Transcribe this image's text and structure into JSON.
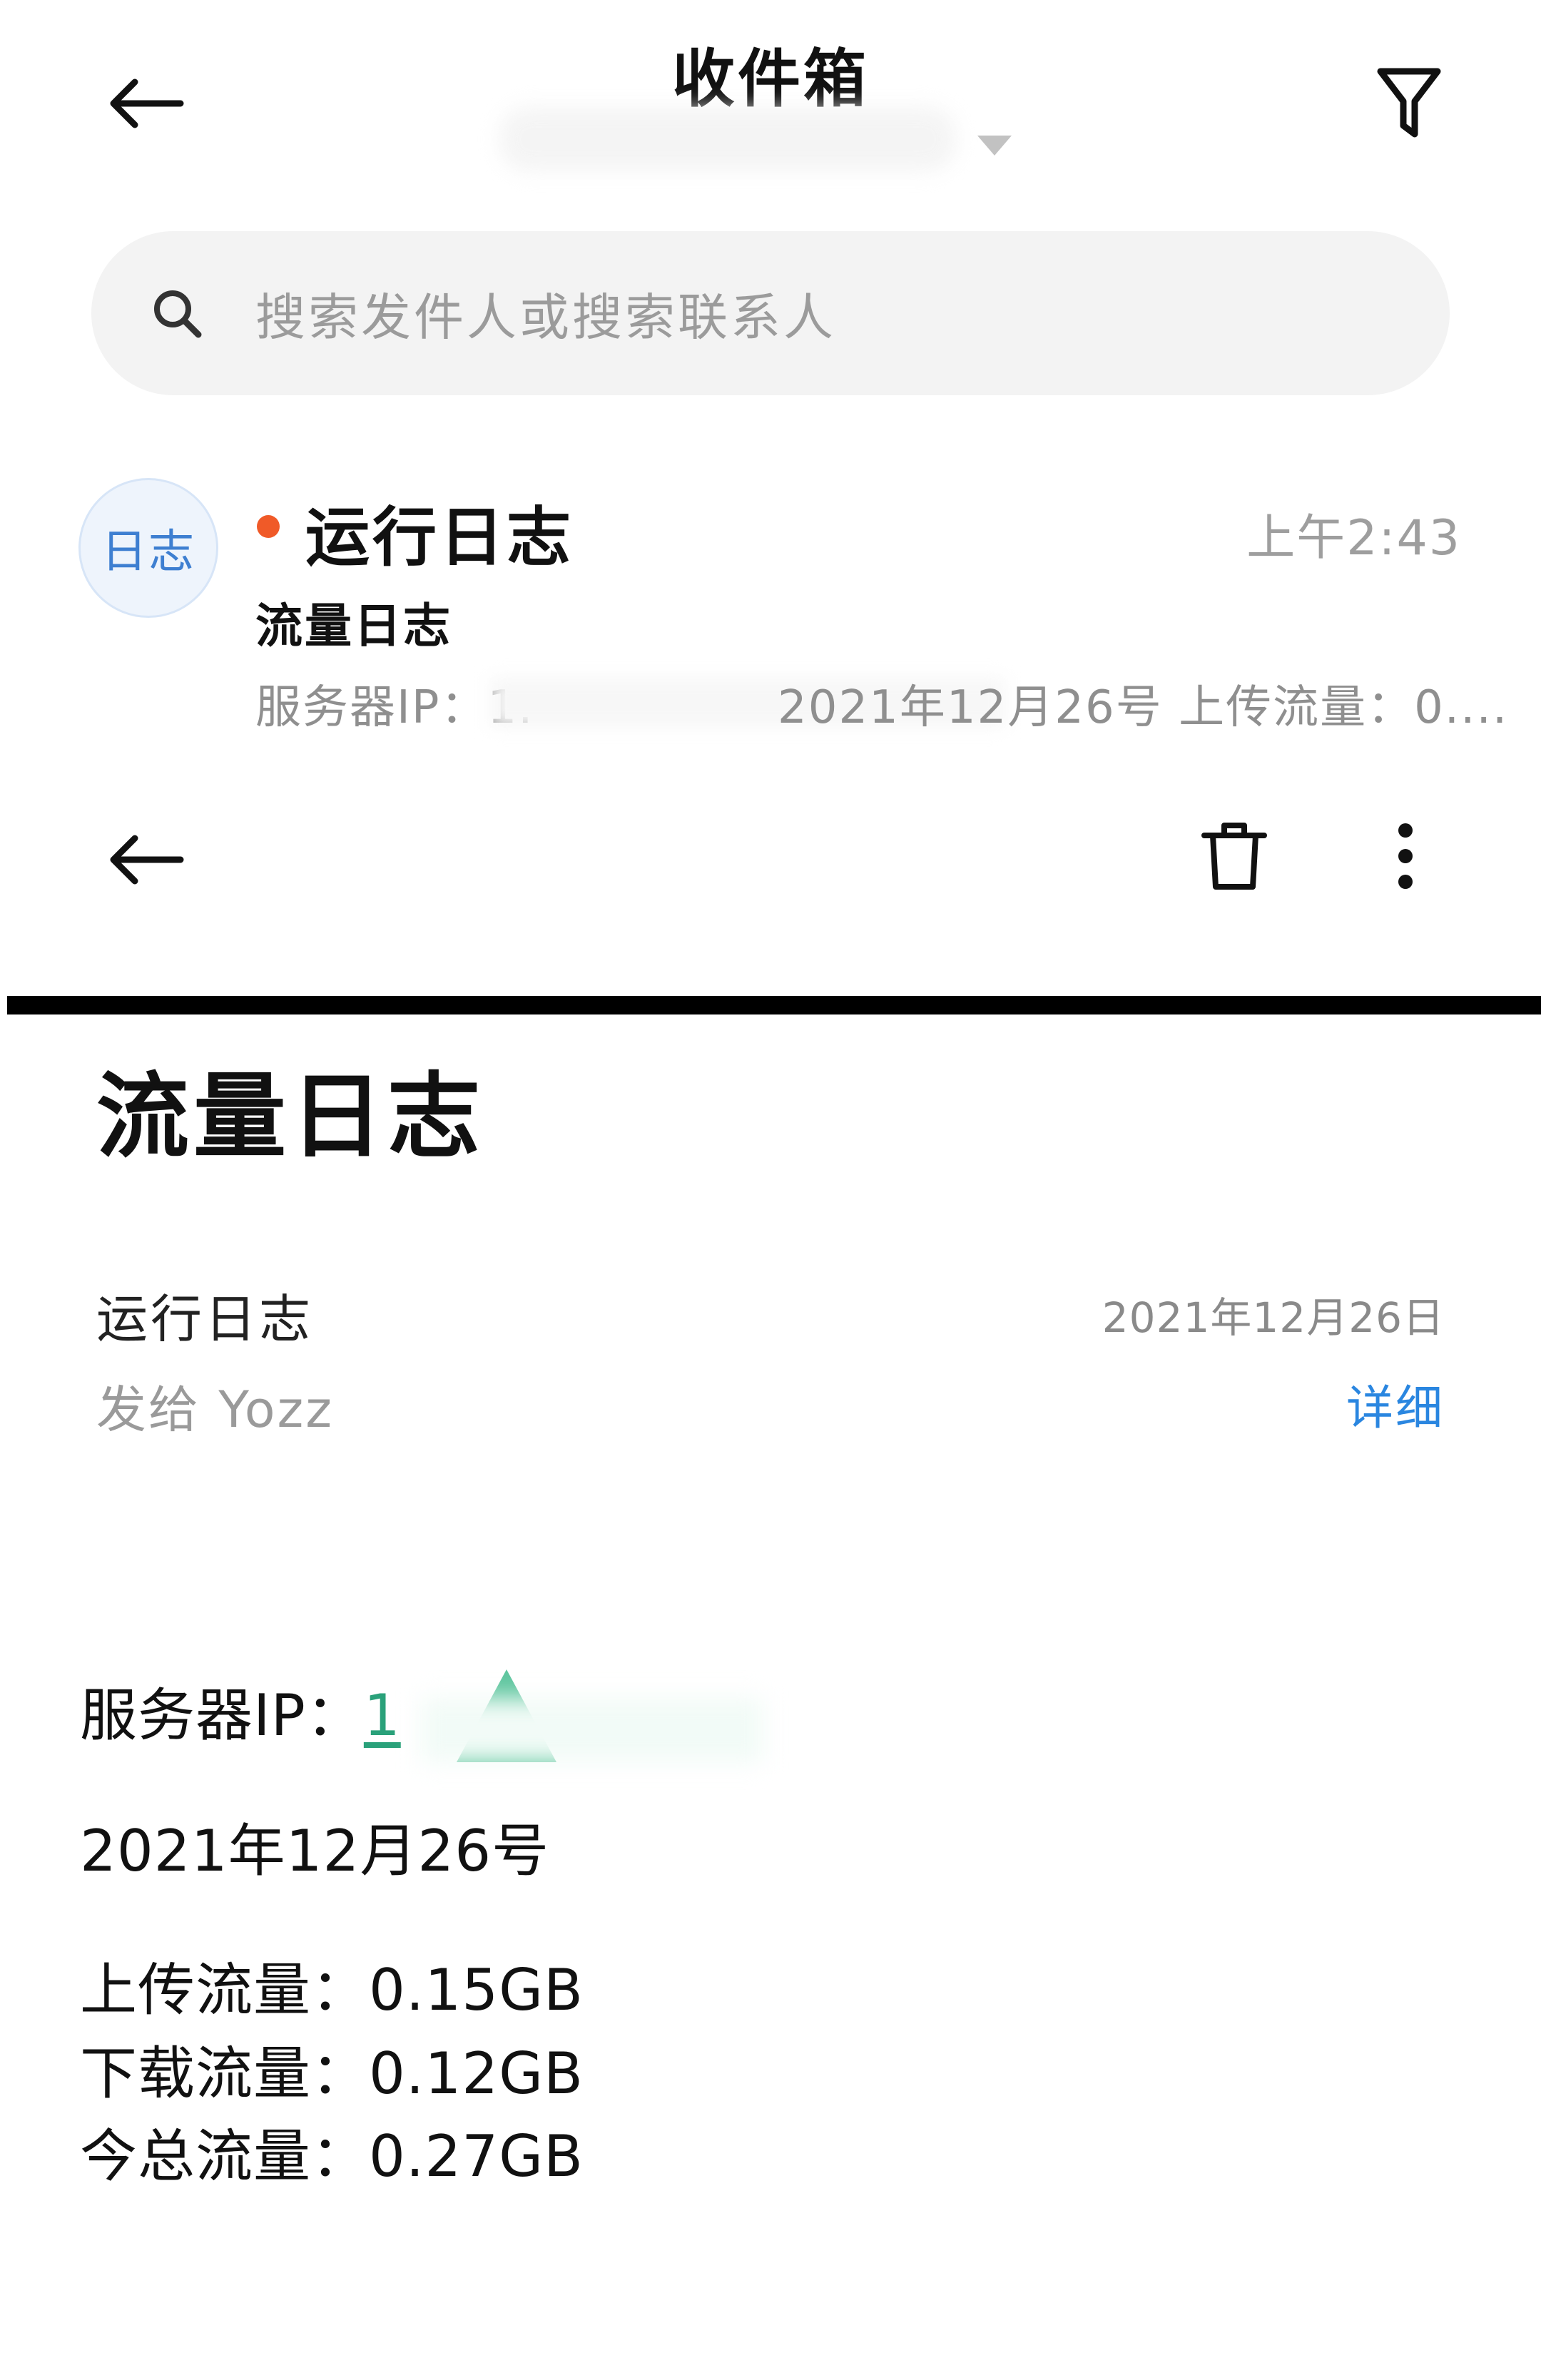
{
  "inbox": {
    "title": "收件箱",
    "search_placeholder": "搜索发件人或搜索联系人",
    "mail": {
      "avatar_text": "日志",
      "sender": "运行日志",
      "time": "上午2:43",
      "subject": "流量日志",
      "preview_start": "服务器IP：1.",
      "preview_end": "2021年12月26号 上传流量：0...."
    }
  },
  "detail": {
    "title": "流量日志",
    "from": "运行日志",
    "date": "2021年12月26日",
    "to": "发给 Yozz",
    "details_link": "详细",
    "body": {
      "ip_label": "服务器IP：",
      "ip_value": "1",
      "date_line": "2021年12月26号",
      "upload": "上传流量：0.15GB",
      "download": "下载流量：0.12GB",
      "total": "今总流量：0.27GB"
    }
  },
  "colors": {
    "unread": "#f05a28",
    "link_blue": "#2a86e0",
    "ip_green": "#2aa17a"
  },
  "icons": [
    "back-arrow-icon",
    "filter-icon",
    "search-icon",
    "trash-icon",
    "more-vertical-icon"
  ]
}
